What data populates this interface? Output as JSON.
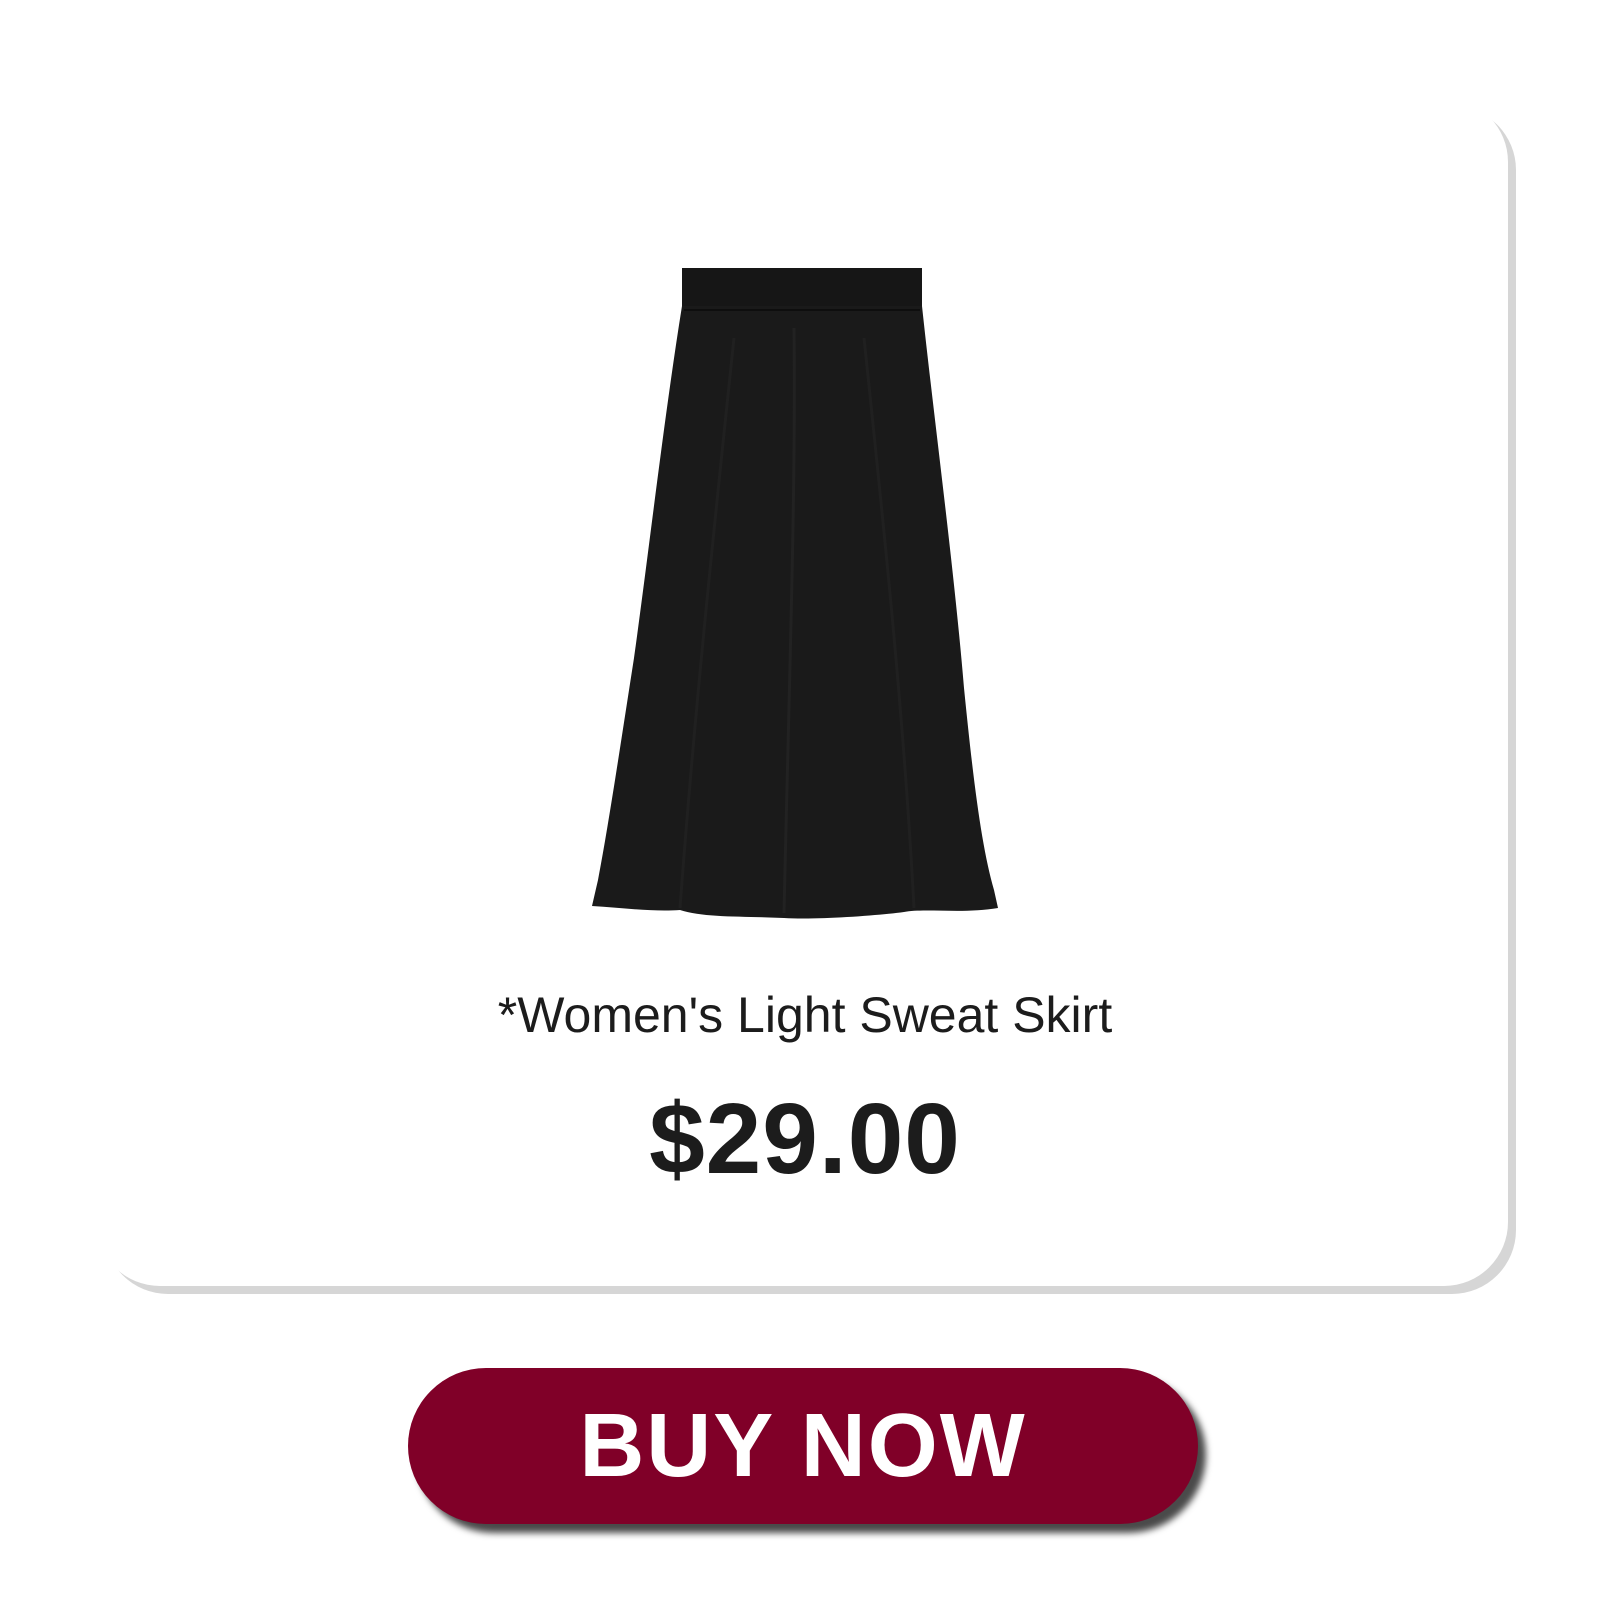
{
  "product": {
    "name": "*Women's Light Sweat Skirt",
    "price": "$29.00",
    "image_icon": "black-midi-skirt"
  },
  "cta": {
    "label": "BUY NOW",
    "color": "#800028"
  }
}
